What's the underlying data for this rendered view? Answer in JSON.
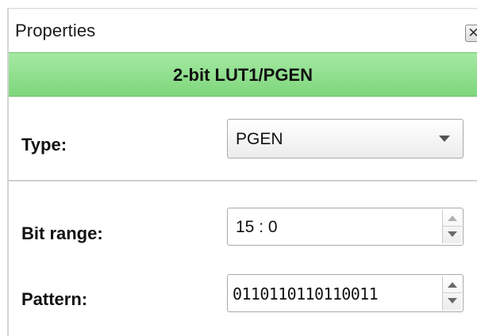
{
  "panel": {
    "title": "Properties",
    "close_symbol": "✕"
  },
  "header": {
    "title": "2-bit LUT1/PGEN",
    "color": "#8fdc8c"
  },
  "fields": {
    "type": {
      "label": "Type:",
      "value": "PGEN"
    },
    "bit_range": {
      "label": "Bit range:",
      "value": "15 : 0"
    },
    "pattern": {
      "label": "Pattern:",
      "value": "0110110110110011"
    }
  },
  "icons": {
    "close": "close-icon",
    "dropdown": "chevron-down-icon",
    "spin_up": "chevron-up-icon",
    "spin_down": "chevron-down-icon"
  }
}
